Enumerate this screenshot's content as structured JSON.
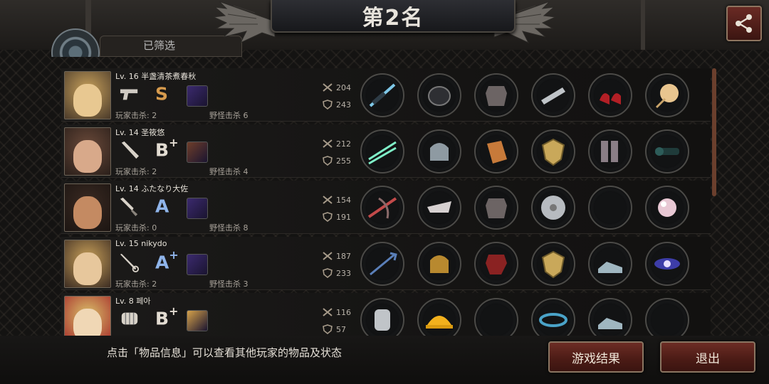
{
  "header": {
    "title": "第2名",
    "hidden_tab_label": "已筛选"
  },
  "hint": "点击「物品信息」可以查看其他玩家的物品及状态",
  "buttons": {
    "game_result": "游戏结果",
    "exit": "退出"
  },
  "colors": {
    "accent": "#6c2d25",
    "grade_s": "#d69a4d",
    "grade_a": "#8fb4ea"
  },
  "players": [
    {
      "level": "Lv. 16",
      "name": "半盏清茶煮春秋",
      "weapon_icon": "pistol-icon",
      "grade": "S",
      "grade_sup": "",
      "player_kills": "玩家击杀: 2",
      "monster_kills": "野怪击杀 6",
      "attack": "204",
      "defense": "243",
      "items": [
        "rifle-icon",
        "helmet-icon",
        "body-armor-icon",
        "arm-guard-icon",
        "high-heels-icon",
        "fan-icon"
      ]
    },
    {
      "level": "Lv. 14",
      "name": "圣筱悠",
      "weapon_icon": "bat-icon",
      "grade": "B",
      "grade_sup": "+",
      "player_kills": "玩家击杀: 2",
      "monster_kills": "野怪击杀 4",
      "attack": "212",
      "defense": "255",
      "items": [
        "twin-swords-icon",
        "knight-helmet-icon",
        "chain-armor-icon",
        "shield-icon",
        "boots-icon",
        "scope-icon"
      ]
    },
    {
      "level": "Lv. 14",
      "name": "ふたなり大佐",
      "weapon_icon": "knife-icon",
      "grade": "A",
      "grade_sup": "",
      "player_kills": "玩家击杀: 0",
      "monster_kills": "野怪击杀 8",
      "attack": "154",
      "defense": "191",
      "items": [
        "crossbow-icon",
        "mask-icon",
        "body-armor-icon",
        "disc-icon",
        "empty-slot-icon",
        "pearl-icon"
      ]
    },
    {
      "level": "Lv. 15",
      "name": "nikydo",
      "weapon_icon": "rapier-icon",
      "grade": "A",
      "grade_sup": "+",
      "player_kills": "玩家击杀: 2",
      "monster_kills": "野怪击杀 3",
      "attack": "187",
      "defense": "233",
      "items": [
        "trident-icon",
        "gladiator-helmet-icon",
        "red-armor-icon",
        "shield-icon",
        "sneakers-icon",
        "galaxy-icon"
      ]
    },
    {
      "level": "Lv. 8",
      "name": "페아",
      "weapon_icon": "fist-icon",
      "grade": "B",
      "grade_sup": "+",
      "player_kills": "",
      "monster_kills": "",
      "attack": "116",
      "defense": "57",
      "items": [
        "gauntlet-icon",
        "hard-hat-icon",
        "empty-slot-icon",
        "bracelet-icon",
        "sneakers-icon",
        "empty-slot-icon"
      ]
    }
  ]
}
